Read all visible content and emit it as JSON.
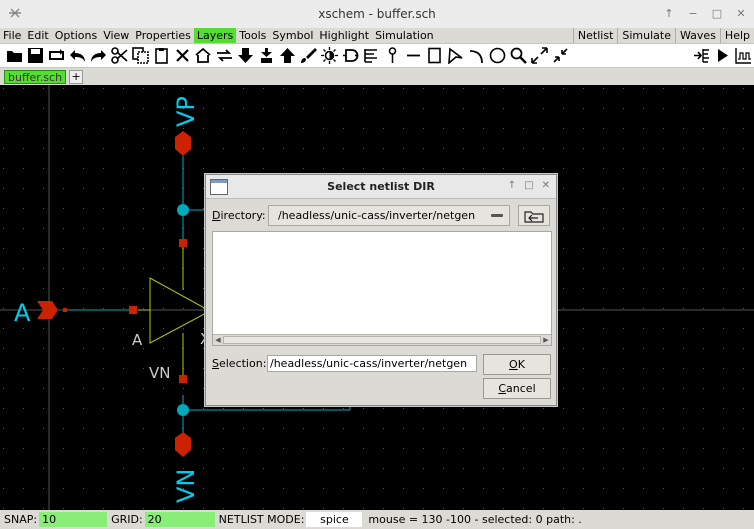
{
  "window": {
    "title": "xschem - buffer.sch"
  },
  "menu": {
    "left": [
      "File",
      "Edit",
      "Options",
      "View",
      "Properties",
      "Layers",
      "Tools",
      "Symbol",
      "Highlight",
      "Simulation"
    ],
    "active": "Layers",
    "right": [
      "Netlist",
      "Simulate",
      "Waves",
      "Help"
    ]
  },
  "tabs": {
    "active": "buffer.sch",
    "add": "+"
  },
  "schematic": {
    "labels": {
      "vp": "VP",
      "vn_bottom": "VN",
      "vn_pin": "VN",
      "a_port": "A",
      "a_pin": "A",
      "y_pin": "X"
    },
    "colors": {
      "wire": "#00aabb",
      "pin": "#cc2200",
      "symbol": "#aacc00",
      "label": "#00ccee",
      "pin_text": "#cccccc"
    }
  },
  "dialog": {
    "title": "Select netlist DIR",
    "directory_label_u": "D",
    "directory_label_rest": "irectory:",
    "directory_value": "/headless/unic-cass/inverter/netgen",
    "selection_label_u": "S",
    "selection_label_rest": "election:",
    "selection_value": "/headless/unic-cass/inverter/netgen",
    "ok_u": "O",
    "ok_rest": "K",
    "cancel_u": "C",
    "cancel_rest": "ancel"
  },
  "status": {
    "snap_label": "SNAP:",
    "snap_value": "10",
    "grid_label": "GRID:",
    "grid_value": "20",
    "mode_label": "NETLIST MODE:",
    "mode_value": "spice",
    "info": "mouse = 130 -100 - selected: 0 path: ."
  }
}
